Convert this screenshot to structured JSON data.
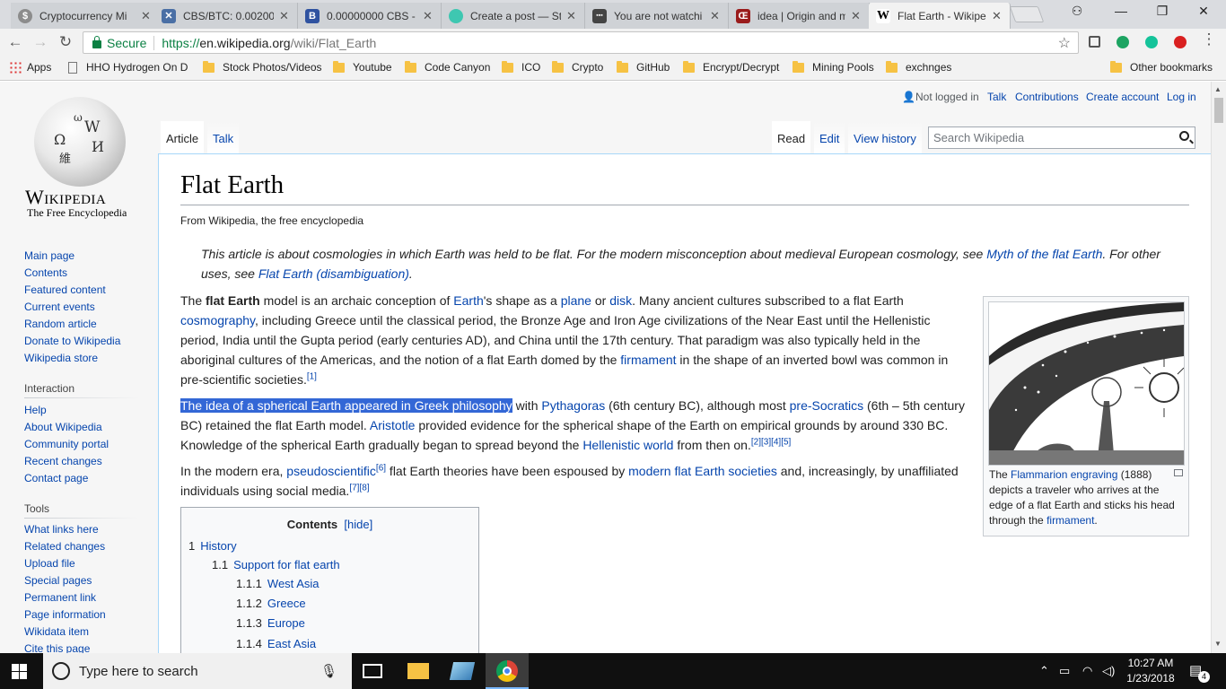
{
  "browser": {
    "tabs": [
      {
        "title": "Cryptocurrency Mi",
        "icon": "coin-icon",
        "color": "#8c8c8c"
      },
      {
        "title": "CBS/BTC: 0.002000",
        "icon": "exchange-icon",
        "color": "#4a6fa5"
      },
      {
        "title": "0.00000000 CBS -",
        "icon": "b-icon",
        "color": "#2f52a0"
      },
      {
        "title": "Create a post — St",
        "icon": "steemit-icon",
        "color": "#3ec7b1"
      },
      {
        "title": "You are not watchi",
        "icon": "video-icon",
        "color": "#444"
      },
      {
        "title": "idea | Origin and m",
        "icon": "etymology-icon",
        "color": "#9a1c1c"
      },
      {
        "title": "Flat Earth - Wikipe",
        "icon": "wikipedia-w-icon",
        "color": "#ffffff",
        "active": true
      }
    ],
    "security_label": "Secure",
    "url": {
      "scheme": "https://",
      "host": "en.wikipedia.org",
      "path": "/wiki/Flat_Earth"
    },
    "bookmarks": [
      "Apps",
      "HHO Hydrogen On D",
      "Stock Photos/Videos",
      "Youtube",
      "Code Canyon",
      "ICO",
      "Crypto",
      "GitHub",
      "Encrypt/Decrypt",
      "Mining Pools",
      "exchnges",
      "Other bookmarks"
    ]
  },
  "wiki": {
    "wordmark": "Wikipedia",
    "tagline": "The Free Encyclopedia",
    "globe_glyphs": [
      "W",
      "Ω",
      "И",
      "維",
      "ω"
    ],
    "nav": [
      "Main page",
      "Contents",
      "Featured content",
      "Current events",
      "Random article",
      "Donate to Wikipedia",
      "Wikipedia store"
    ],
    "interaction_heading": "Interaction",
    "interaction": [
      "Help",
      "About Wikipedia",
      "Community portal",
      "Recent changes",
      "Contact page"
    ],
    "tools_heading": "Tools",
    "tools": [
      "What links here",
      "Related changes",
      "Upload file",
      "Special pages",
      "Permanent link",
      "Page information",
      "Wikidata item",
      "Cite this page"
    ],
    "personal": {
      "not_logged_in": "Not logged in",
      "talk": "Talk",
      "contributions": "Contributions",
      "create_account": "Create account",
      "log_in": "Log in"
    },
    "page_tabs": {
      "article": "Article",
      "talk": "Talk",
      "read": "Read",
      "edit": "Edit",
      "view_history": "View history"
    },
    "search_placeholder": "Search Wikipedia",
    "title": "Flat Earth",
    "from": "From Wikipedia, the free encyclopedia",
    "hatnote": {
      "t1": "This article is about cosmologies in which Earth was held to be flat. For the modern misconception about medieval European cosmology, see ",
      "l1": "Myth of the flat Earth",
      "t2": ". For other uses, see ",
      "l2": "Flat Earth (disambiguation)",
      "t3": "."
    },
    "p1": {
      "a": "The ",
      "b": "flat Earth",
      "c": " model is an archaic conception of ",
      "earth": "Earth",
      "d": "'s shape as a ",
      "plane": "plane",
      "e": " or ",
      "disk": "disk",
      "f": ". Many ancient cultures subscribed to a flat Earth ",
      "cosmography": "cosmography",
      "g": ", including Greece until the classical period, the Bronze Age and Iron Age civilizations of the Near East until the Hellenistic period, India until the Gupta period (early centuries AD), and China until the 17th century. That paradigm was also typically held in the aboriginal cultures of the Americas, and the notion of a flat Earth domed by the ",
      "firmament": "firmament",
      "h": " in the shape of an inverted bowl was common in pre-scientific societies.",
      "ref": "[1]"
    },
    "p2": {
      "selected": "The idea of a spherical Earth appeared in Greek philosophy",
      "a": " with ",
      "pythagoras": "Pythagoras",
      "b": " (6th century BC), although most ",
      "presocratics": "pre-Socratics",
      "c": " (6th – 5th century BC) retained the flat Earth model. ",
      "aristotle": "Aristotle",
      "d": " provided evidence for the spherical shape of the Earth on empirical grounds by around 330 BC. Knowledge of the spherical Earth gradually began to spread beyond the ",
      "hellenistic": "Hellenistic world",
      "e": " from then on.",
      "refs": "[2][3][4][5]"
    },
    "p3": {
      "a": "In the modern era, ",
      "pseudo": "pseudoscientific",
      "ref6": "[6]",
      "b": " flat Earth theories have been espoused by ",
      "societies": "modern flat Earth societies",
      "c": " and, increasingly, by unaffiliated individuals using social media.",
      "refs": "[7][8]"
    },
    "thumb_caption": {
      "a": "The ",
      "link": "Flammarion engraving",
      "b": " (1888) depicts a traveler who arrives at the edge of a flat Earth and sticks his head through the ",
      "firmament": "firmament",
      "c": "."
    },
    "toc": {
      "title": "Contents",
      "hide": "[hide]",
      "items": [
        {
          "num": "1",
          "label": "History"
        },
        {
          "num": "1.1",
          "label": "Support for flat earth"
        },
        {
          "num": "1.1.1",
          "label": "West Asia"
        },
        {
          "num": "1.1.2",
          "label": "Greece"
        },
        {
          "num": "1.1.3",
          "label": "Europe"
        },
        {
          "num": "1.1.4",
          "label": "East Asia"
        }
      ]
    }
  },
  "taskbar": {
    "search_placeholder": "Type here to search",
    "time": "10:27 AM",
    "date": "1/23/2018",
    "notifications": "4"
  }
}
